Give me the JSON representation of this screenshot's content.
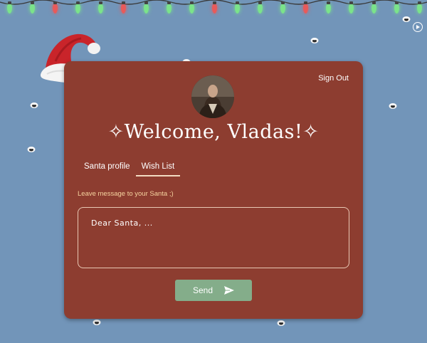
{
  "header": {
    "play_icon": "play-circle-icon"
  },
  "lights": {
    "colors": [
      "#7be38a",
      "#7be38a",
      "#e85a5a",
      "#7be38a",
      "#7be38a",
      "#e85a5a",
      "#7be38a",
      "#7be38a",
      "#7be38a",
      "#e85a5a",
      "#7be38a",
      "#7be38a",
      "#7be38a",
      "#e85a5a",
      "#7be38a",
      "#7be38a",
      "#7be38a"
    ]
  },
  "card": {
    "sign_out_label": "Sign Out",
    "welcome_title": "✧Welcome, Vladas!✧",
    "tabs": [
      {
        "label": "Santa profile",
        "active": false
      },
      {
        "label": "Wish List",
        "active": true
      }
    ],
    "message_label": "Leave message to your Santa ;)",
    "message_placeholder": "Dear Santa, ...",
    "send_label": "Send",
    "send_icon": "paper-plane-icon"
  },
  "colors": {
    "background": "#7295b9",
    "card": "#8d3d30",
    "send_button": "#84ad8a",
    "label_accent": "#f6d4a0"
  }
}
